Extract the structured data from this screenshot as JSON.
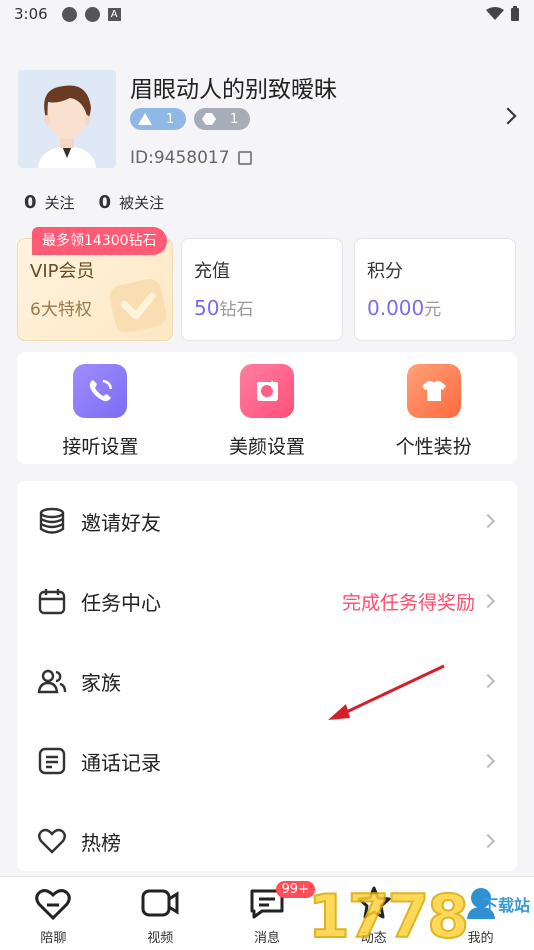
{
  "status": {
    "time": "3:06"
  },
  "profile": {
    "nickname": "眉眼动人的别致暧昧",
    "badge1": "1",
    "badge2": "1",
    "uid": "ID:9458017"
  },
  "follow": {
    "following_count": "0",
    "following_label": "关注",
    "followers_count": "0",
    "followers_label": "被关注"
  },
  "cards": {
    "vip_tag": "最多领14300钻石",
    "vip_title": "VIP会员",
    "vip_sub": "6大特权",
    "recharge_title": "充值",
    "recharge_value": "50",
    "recharge_unit": "钻石",
    "points_title": "积分",
    "points_value": "0.000",
    "points_unit": "元"
  },
  "quick": [
    {
      "label": "接听设置",
      "icon": "phone-icon",
      "color": "#8a7cf5"
    },
    {
      "label": "美颜设置",
      "icon": "beauty-icon",
      "color": "#ff5f86"
    },
    {
      "label": "个性装扮",
      "icon": "dressup-icon",
      "color": "#ff7a4d"
    }
  ],
  "menu": [
    {
      "label": "邀请好友",
      "icon": "coins-icon",
      "extra": ""
    },
    {
      "label": "任务中心",
      "icon": "calendar-icon",
      "extra": "完成任务得奖励"
    },
    {
      "label": "家族",
      "icon": "users-icon",
      "extra": ""
    },
    {
      "label": "通话记录",
      "icon": "document-icon",
      "extra": ""
    },
    {
      "label": "热榜",
      "icon": "heart-outline-icon",
      "extra": ""
    }
  ],
  "tabs": [
    {
      "label": "陪聊",
      "icon": "heart-chat-icon"
    },
    {
      "label": "视频",
      "icon": "video-icon"
    },
    {
      "label": "消息",
      "icon": "message-icon",
      "badge": "99+"
    },
    {
      "label": "动态",
      "icon": "star-icon"
    },
    {
      "label": "我的",
      "icon": "profile-icon"
    }
  ],
  "watermark": {
    "text": "1778",
    "sub": "下载站"
  }
}
